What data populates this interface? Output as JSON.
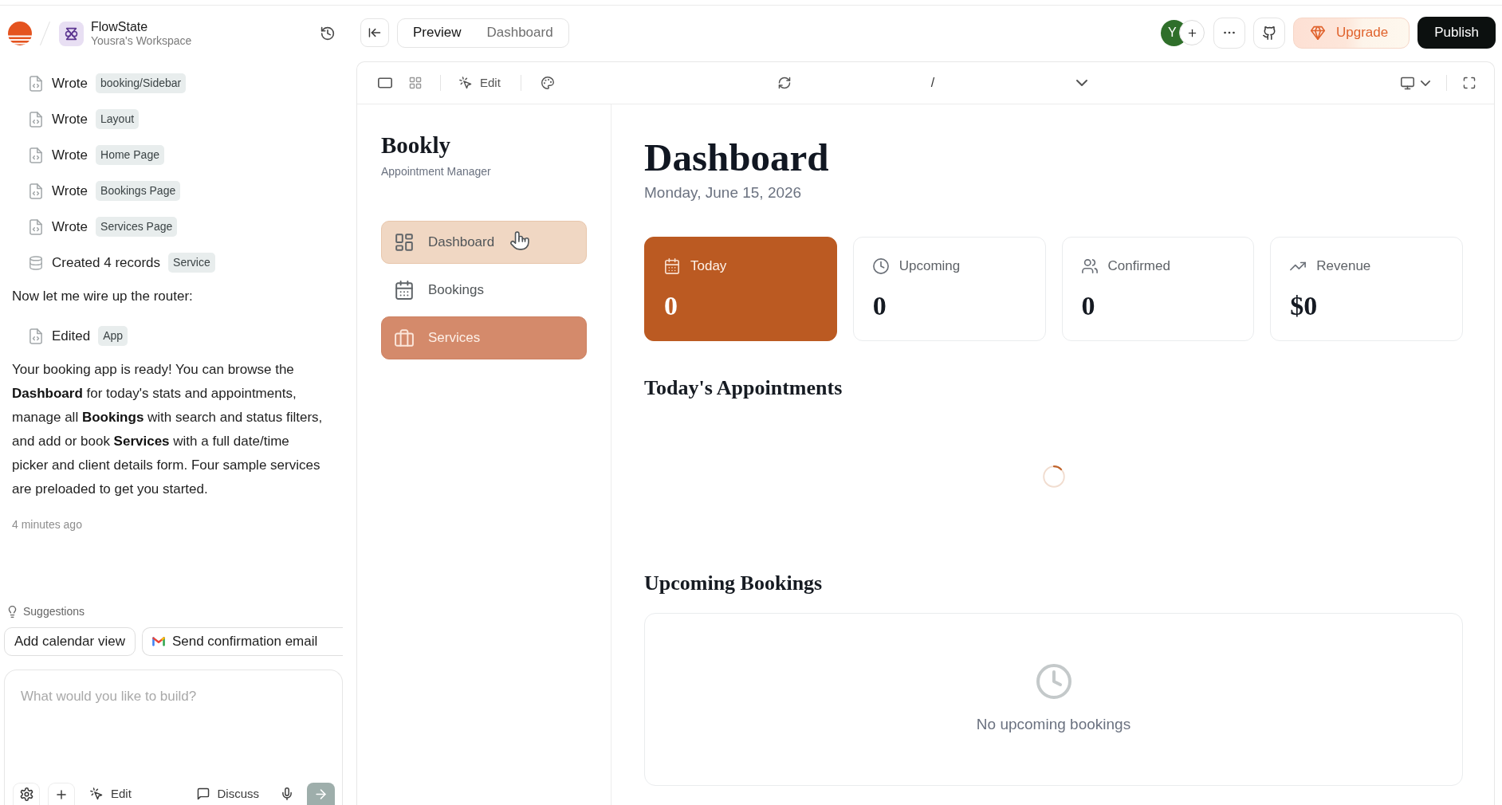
{
  "workspace": {
    "name": "FlowState",
    "subtitle": "Yousra's Workspace"
  },
  "chat": {
    "entries": [
      {
        "kind": "file",
        "action": "Wrote",
        "target": "booking/Sidebar"
      },
      {
        "kind": "file",
        "action": "Wrote",
        "target": "Layout"
      },
      {
        "kind": "file",
        "action": "Wrote",
        "target": "Home Page"
      },
      {
        "kind": "file",
        "action": "Wrote",
        "target": "Bookings Page"
      },
      {
        "kind": "file",
        "action": "Wrote",
        "target": "Services Page"
      },
      {
        "kind": "records",
        "action": "Created 4 records",
        "target": "Service"
      },
      {
        "kind": "message",
        "text": "Now let me wire up the router:"
      },
      {
        "kind": "file",
        "action": "Edited",
        "target": "App"
      },
      {
        "kind": "message",
        "text": "Your booking app is ready! You can browse the **Dashboard** for today's stats and appointments, manage all **Bookings** with search and status filters, and add or book **Services** with a full date/time picker and client details form. Four sample services are preloaded to get you started."
      }
    ],
    "time": "4 minutes ago"
  },
  "suggestions": {
    "title": "Suggestions",
    "items": [
      {
        "kind": "plain",
        "label": "Add calendar view"
      },
      {
        "kind": "gmail",
        "label": "Send confirmation email"
      }
    ]
  },
  "composer": {
    "placeholder": "What would you like to build?",
    "tools": [
      {
        "kind": "settings"
      },
      {
        "kind": "attach"
      },
      {
        "kind": "edit",
        "label": "Edit"
      },
      {
        "kind": "discuss",
        "label": "Discuss"
      },
      {
        "kind": "voice"
      },
      {
        "kind": "send"
      }
    ]
  },
  "topbar": {
    "tabs": [
      {
        "label": "Preview",
        "selected": true
      },
      {
        "label": "Dashboard",
        "selected": false
      }
    ],
    "avatar": "Y",
    "upgrade": "Upgrade",
    "publish": "Publish"
  },
  "preview_toolbar": {
    "views": [
      {
        "selected": true
      },
      {
        "selected": false
      }
    ],
    "edit": "Edit",
    "path": "/"
  },
  "app": {
    "brand": "Bookly",
    "tagline": "Appointment Manager",
    "nav": [
      {
        "label": "Dashboard",
        "selected": false,
        "hovered": true
      },
      {
        "label": "Bookings",
        "selected": false,
        "hovered": false
      },
      {
        "label": "Services",
        "selected": true,
        "hovered": false
      }
    ],
    "title": "Dashboard",
    "date": "Monday, June 15, 2026",
    "stats": [
      {
        "label": "Today",
        "value": "0",
        "highlighted": true
      },
      {
        "label": "Upcoming",
        "value": "0",
        "highlighted": false
      },
      {
        "label": "Confirmed",
        "value": "0",
        "highlighted": false
      },
      {
        "label": "Revenue",
        "value": "$0",
        "highlighted": false
      }
    ],
    "sections": [
      {
        "kind": "loading",
        "title": "Today's Appointments"
      },
      {
        "kind": "empty",
        "title": "Upcoming Bookings",
        "message": "No upcoming bookings"
      }
    ]
  }
}
